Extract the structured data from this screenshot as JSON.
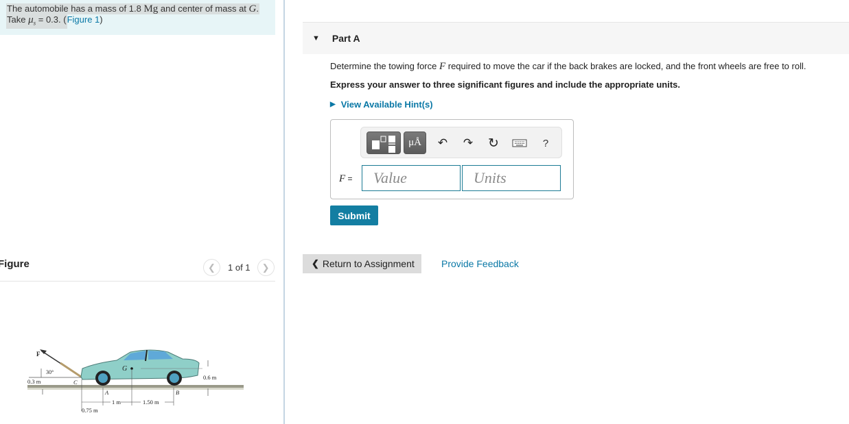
{
  "problem": {
    "text_part1": "The automobile has a mass of 1.8 ",
    "mass_unit": "Mg",
    "text_part2": " and center of mass at ",
    "center_symbol": "G",
    "text_part3": ".",
    "line2_prefix": "Take ",
    "mu_symbol": "μ",
    "mu_subscript": "s",
    "line2_value": " = 0.3. (",
    "figure_link": "Figure 1",
    "line2_suffix": ")"
  },
  "figure_panel": {
    "title": "Figure",
    "prev_icon": "chevron-left-icon",
    "next_icon": "chevron-right-icon",
    "count": "1 of 1",
    "diagram": {
      "force_label": "F",
      "angle_label": "30°",
      "point_labels": [
        "C",
        "A",
        "B",
        "G"
      ],
      "height_c": "0.3 m",
      "height_g": "0.6 m",
      "dim_ca": "0.75 m",
      "dim_ag": "1 m",
      "dim_gb": "1.50 m"
    }
  },
  "part": {
    "toggle_icon": "triangle-down-icon",
    "title": "Part A",
    "question_pre": "Determine the towing force ",
    "question_var": "F",
    "question_post": " required to move the car if the back brakes are locked, and the front wheels are free to roll.",
    "instruction": "Express your answer to three significant figures and include the appropriate units.",
    "hints_label": "View Available Hint(s)"
  },
  "answer": {
    "toolbar": {
      "templates_icon": "templates-icon",
      "units_label": "μÅ",
      "undo_icon": "undo-icon",
      "redo_icon": "redo-icon",
      "reset_icon": "reset-icon",
      "keyboard_icon": "keyboard-icon",
      "help_label": "?"
    },
    "variable": "F",
    "equals": " =",
    "value": "",
    "value_placeholder": "Value",
    "units": "",
    "units_placeholder": "Units",
    "submit_label": "Submit"
  },
  "footer": {
    "return_label": "Return to Assignment",
    "feedback_label": "Provide Feedback"
  },
  "colors": {
    "accent": "#137ea2",
    "link": "#0a78a6",
    "problem_bg": "#e7f5f7",
    "car": "#8fcfc8"
  }
}
